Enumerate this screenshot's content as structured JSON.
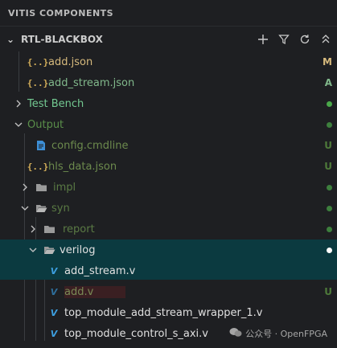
{
  "panel": {
    "title": "VITIS COMPONENTS"
  },
  "section": {
    "title": "RTL-BLACKBOX",
    "toolbar": [
      {
        "name": "new-icon",
        "glyph": "+"
      },
      {
        "name": "filter-icon",
        "glyph": "⊽"
      },
      {
        "name": "refresh-icon",
        "glyph": "↻"
      },
      {
        "name": "collapse-all-icon",
        "glyph": "⌃"
      }
    ]
  },
  "tree": {
    "add_json": {
      "label": "add.json",
      "status": "M"
    },
    "add_stream_json": {
      "label": "add_stream.json",
      "status": "A"
    },
    "test_bench": {
      "label": "Test Bench"
    },
    "output": {
      "label": "Output"
    },
    "config_cmdline": {
      "label": "config.cmdline",
      "status": "U"
    },
    "hls_data_json": {
      "label": "hls_data.json",
      "status": "U"
    },
    "impl": {
      "label": "impl"
    },
    "syn": {
      "label": "syn"
    },
    "report": {
      "label": "report"
    },
    "verilog": {
      "label": "verilog"
    },
    "add_stream_v": {
      "label": "add_stream.v"
    },
    "add_v": {
      "label": "add.v",
      "status": "U"
    },
    "wrapper_v": {
      "label": "top_module_add_stream_wrapper_1.v"
    },
    "control_v": {
      "label": "top_module_control_s_axi.v"
    }
  },
  "colors": {
    "modified": "#d7ba7d",
    "added": "#81b88b",
    "untracked": "#73c991",
    "ignored": "#6c8a4d",
    "green_dot": "#4aa84a",
    "white_dot": "#ffffff",
    "selected_bg": "#0b3a40"
  },
  "watermark": {
    "text": "公众号 · OpenFPGA"
  }
}
